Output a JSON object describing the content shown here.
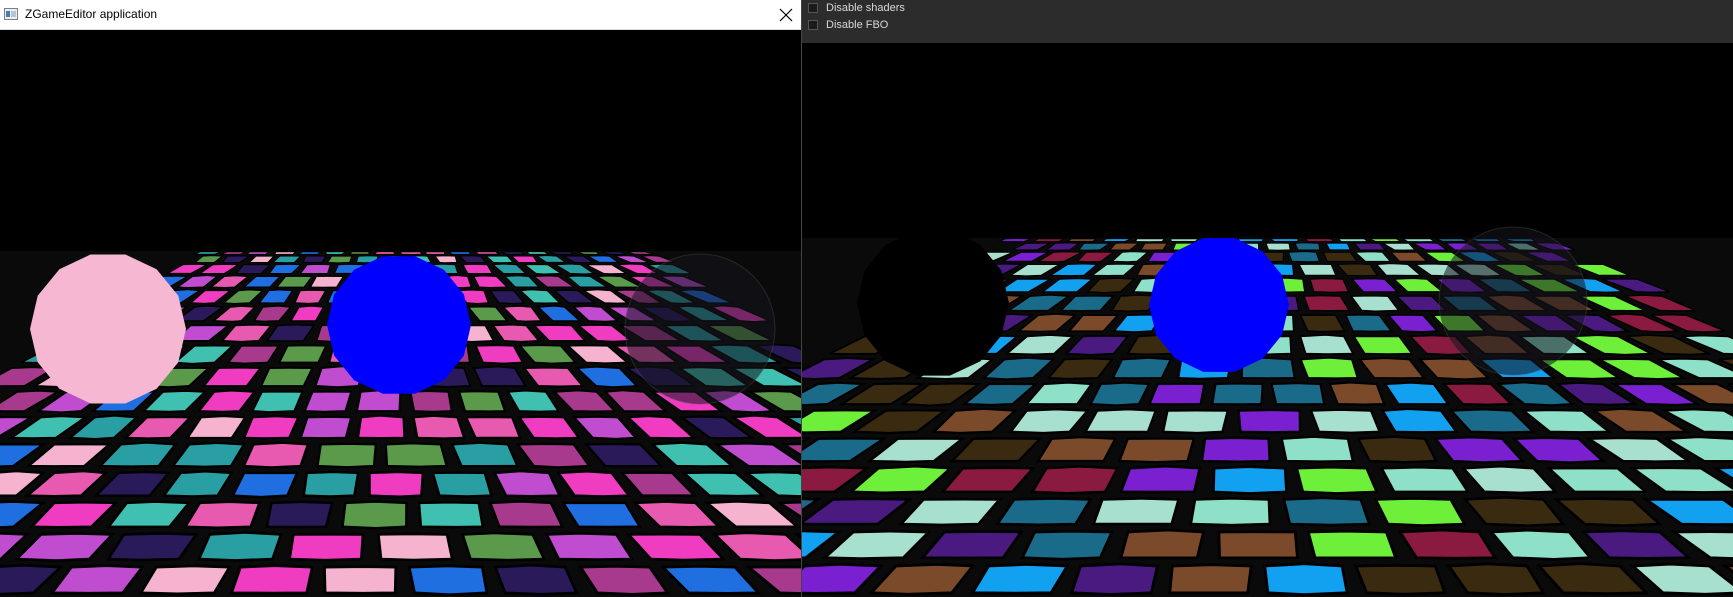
{
  "window": {
    "title": "ZGameEditor application",
    "icon": "app-window-icon",
    "close_icon": "close-icon"
  },
  "options": {
    "items": [
      {
        "label": "Disable shaders",
        "checked": false
      },
      {
        "label": "Disable FBO",
        "checked": false
      }
    ]
  },
  "scenes": {
    "left": {
      "tile_palette": [
        "#f03cc0",
        "#2a9fa3",
        "#1f6fe0",
        "#a83a8e",
        "#2a1a5a",
        "#f5b3d0",
        "#5a9a4a",
        "#c04cd0",
        "#3fc0b0",
        "#e85ab0"
      ],
      "spheres": [
        "#f6b7d2",
        "#0000ff",
        "translucent"
      ]
    },
    "right": {
      "tile_palette": [
        "#6ef03a",
        "#7a20d0",
        "#8a1a40",
        "#12a0f0",
        "#8ee0c8",
        "#7a4a2a",
        "#3a2a10",
        "#1a6a8a",
        "#a8e0d0",
        "#4a1a80"
      ],
      "spheres": [
        "#000000",
        "#0000ff",
        "translucent"
      ]
    }
  }
}
